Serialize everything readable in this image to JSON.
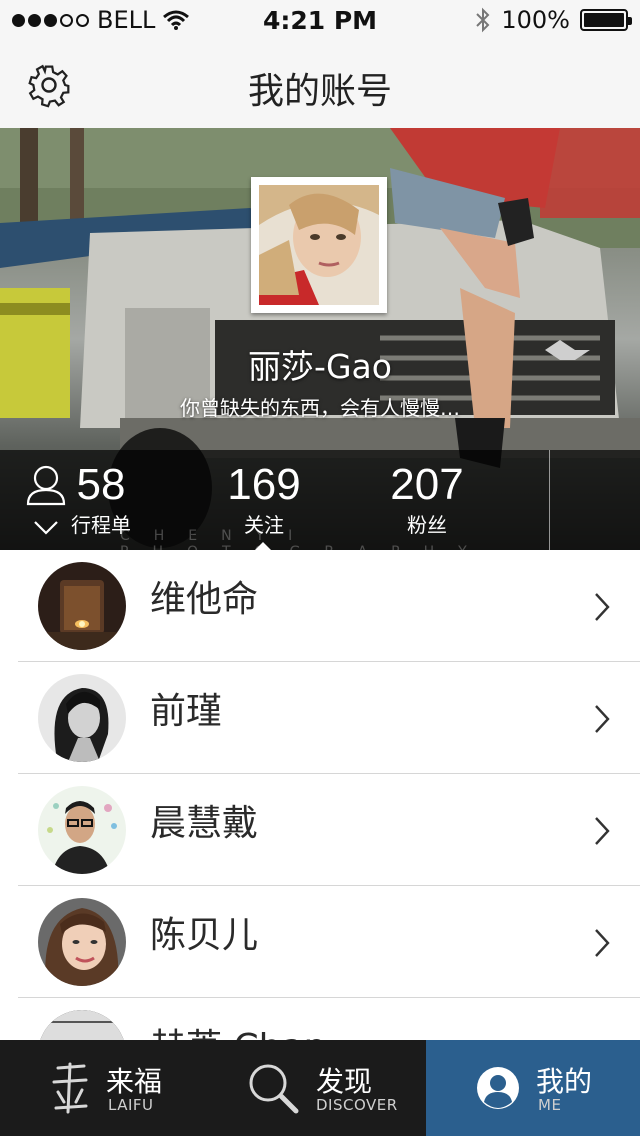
{
  "status_bar": {
    "carrier": "BELL",
    "time": "4:21 PM",
    "battery": "100%",
    "battery_level": 1.0,
    "signal_bars": 3
  },
  "nav": {
    "title": "我的账号"
  },
  "profile": {
    "name": "丽莎-Gao",
    "bio": "你曾缺失的东西，会有人慢慢…",
    "watermark": "CHENYI PHOTOGRAPHY"
  },
  "stats": [
    {
      "value": "58",
      "label": "行程单"
    },
    {
      "value": "169",
      "label": "关注"
    },
    {
      "value": "207",
      "label": "粉丝"
    }
  ],
  "following": [
    {
      "name": "维他命"
    },
    {
      "name": "前瑾"
    },
    {
      "name": "晨慧戴"
    },
    {
      "name": "陈贝儿"
    },
    {
      "name": "赫苒 Chan"
    }
  ],
  "tabs": [
    {
      "cn": "来福",
      "en": "LAIFU",
      "icon": "laifu-logo-icon"
    },
    {
      "cn": "发现",
      "en": "DISCOVER",
      "icon": "search-icon"
    },
    {
      "cn": "我的",
      "en": "ME",
      "icon": "profile-icon"
    }
  ],
  "colors": {
    "active_tab": "#2b5f8e",
    "tab_bar": "#1b1b1b"
  }
}
